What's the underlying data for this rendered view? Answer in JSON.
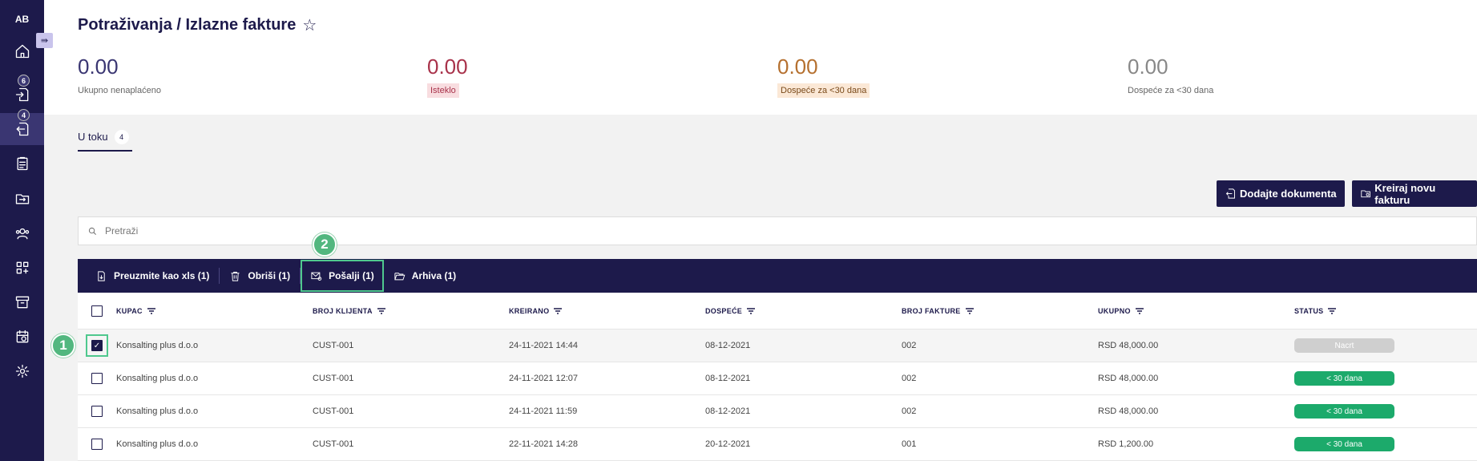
{
  "sidebar": {
    "avatar": "AB",
    "collapse_icon": "collapse-arrow-icon",
    "items": [
      {
        "icon": "home-icon",
        "badge": ""
      },
      {
        "icon": "incoming-document-icon",
        "badge": "6"
      },
      {
        "icon": "outgoing-document-icon",
        "badge": "4"
      },
      {
        "icon": "clipboard-icon",
        "badge": ""
      },
      {
        "icon": "transfer-folder-icon",
        "badge": ""
      },
      {
        "icon": "contacts-icon",
        "badge": ""
      },
      {
        "icon": "apps-grid-icon",
        "badge": ""
      },
      {
        "icon": "archive-icon",
        "badge": ""
      },
      {
        "icon": "calendar-sync-icon",
        "badge": ""
      },
      {
        "icon": "settings-icon",
        "badge": ""
      }
    ]
  },
  "header": {
    "title": "Potraživanja / Izlazne fakture",
    "stats": [
      {
        "value": "0.00",
        "label": "Ukupno nenaplaćeno",
        "color": "#3a3672"
      },
      {
        "value": "0.00",
        "label": "Isteklo",
        "color": "#a8324a"
      },
      {
        "value": "0.00",
        "label": "Dospeće za <30 dana",
        "color": "#b5702f"
      },
      {
        "value": "0.00",
        "label": "Dospeće za <30 dana",
        "color": "#888888"
      }
    ]
  },
  "tabs": [
    {
      "label": "U toku",
      "count": "4"
    }
  ],
  "actions": {
    "add_documents": "Dodajte dokumenta",
    "create_invoice": "Kreiraj novu fakturu"
  },
  "search": {
    "placeholder": "Pretraži"
  },
  "bulk_actions": {
    "export_xls": "Preuzmite kao xls (1)",
    "delete": "Obriši (1)",
    "send": "Pošalji (1)",
    "archive": "Arhiva (1)"
  },
  "table": {
    "columns": [
      "KUPAC",
      "BROJ KLIJENTA",
      "KREIRANO",
      "DOSPEĆE",
      "BROJ FAKTURE",
      "UKUPNO",
      "STATUS"
    ],
    "rows": [
      {
        "kupac": "Konsalting plus d.o.o",
        "broj_klijenta": "CUST-001",
        "kreirano": "24-11-2021 14:44",
        "dospece": "08-12-2021",
        "broj_fakture": "002",
        "ukupno": "RSD 48,000.00",
        "status": "Nacrt",
        "checked": true
      },
      {
        "kupac": "Konsalting plus d.o.o",
        "broj_klijenta": "CUST-001",
        "kreirano": "24-11-2021 12:07",
        "dospece": "08-12-2021",
        "broj_fakture": "002",
        "ukupno": "RSD 48,000.00",
        "status": "< 30 dana",
        "checked": false
      },
      {
        "kupac": "Konsalting plus d.o.o",
        "broj_klijenta": "CUST-001",
        "kreirano": "24-11-2021 11:59",
        "dospece": "08-12-2021",
        "broj_fakture": "002",
        "ukupno": "RSD 48,000.00",
        "status": "< 30 dana",
        "checked": false
      },
      {
        "kupac": "Konsalting plus d.o.o",
        "broj_klijenta": "CUST-001",
        "kreirano": "22-11-2021 14:28",
        "dospece": "20-12-2021",
        "broj_fakture": "001",
        "ukupno": "RSD 1,200.00",
        "status": "< 30 dana",
        "checked": false
      }
    ]
  },
  "callouts": [
    "1",
    "2"
  ],
  "colors": {
    "brand": "#1d1a4b",
    "status_green": "#1caa6b",
    "status_draft": "#cfcfcf",
    "highlight": "#4fc88e"
  }
}
